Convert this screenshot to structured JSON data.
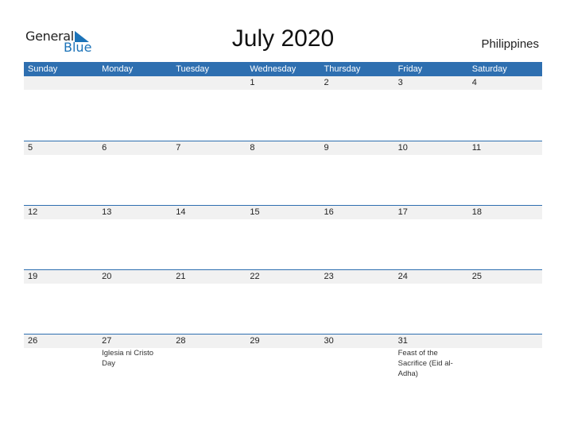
{
  "logo": {
    "general": "General",
    "blue": "Blue"
  },
  "title": "July 2020",
  "country": "Philippines",
  "weekdays": [
    "Sunday",
    "Monday",
    "Tuesday",
    "Wednesday",
    "Thursday",
    "Friday",
    "Saturday"
  ],
  "weeks": [
    [
      {
        "d": ""
      },
      {
        "d": ""
      },
      {
        "d": ""
      },
      {
        "d": "1"
      },
      {
        "d": "2"
      },
      {
        "d": "3"
      },
      {
        "d": "4"
      }
    ],
    [
      {
        "d": "5"
      },
      {
        "d": "6"
      },
      {
        "d": "7"
      },
      {
        "d": "8"
      },
      {
        "d": "9"
      },
      {
        "d": "10"
      },
      {
        "d": "11"
      }
    ],
    [
      {
        "d": "12"
      },
      {
        "d": "13"
      },
      {
        "d": "14"
      },
      {
        "d": "15"
      },
      {
        "d": "16"
      },
      {
        "d": "17"
      },
      {
        "d": "18"
      }
    ],
    [
      {
        "d": "19"
      },
      {
        "d": "20"
      },
      {
        "d": "21"
      },
      {
        "d": "22"
      },
      {
        "d": "23"
      },
      {
        "d": "24"
      },
      {
        "d": "25"
      }
    ],
    [
      {
        "d": "26"
      },
      {
        "d": "27",
        "e": "Iglesia ni Cristo Day"
      },
      {
        "d": "28"
      },
      {
        "d": "29"
      },
      {
        "d": "30"
      },
      {
        "d": "31",
        "e": "Feast of the Sacrifice (Eid al-Adha)"
      },
      {
        "d": ""
      }
    ]
  ]
}
